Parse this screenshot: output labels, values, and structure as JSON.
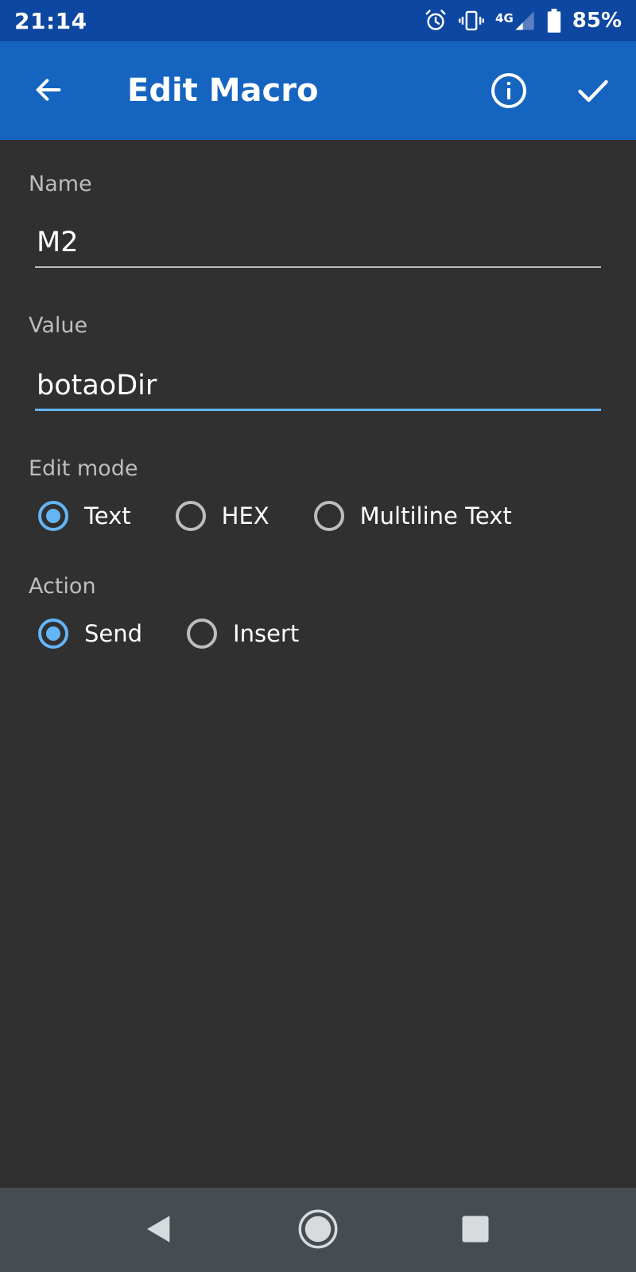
{
  "status_bar": {
    "time": "21:14",
    "network": "4G",
    "battery": "85%",
    "icons": [
      "alarm-icon",
      "vibrate-icon",
      "signal-icon",
      "battery-icon"
    ]
  },
  "app_bar": {
    "title": "Edit Macro",
    "icons": [
      "back-arrow-icon",
      "info-icon",
      "checkmark-icon"
    ]
  },
  "form": {
    "name_label": "Name",
    "name_value": "M2",
    "value_label": "Value",
    "value_value": "botaoDir",
    "edit_mode": {
      "label": "Edit mode",
      "options": [
        "Text",
        "HEX",
        "Multiline Text"
      ],
      "selected": "Text"
    },
    "action": {
      "label": "Action",
      "options": [
        "Send",
        "Insert"
      ],
      "selected": "Send"
    }
  },
  "colors": {
    "status_bar": "#0D47A1",
    "app_bar": "#1565C0",
    "background": "#303030",
    "accent": "#64B5F6",
    "nav_bar": "#454C52"
  },
  "nav_bar": {
    "icons": [
      "nav-back-icon",
      "nav-home-icon",
      "nav-recents-icon"
    ]
  }
}
